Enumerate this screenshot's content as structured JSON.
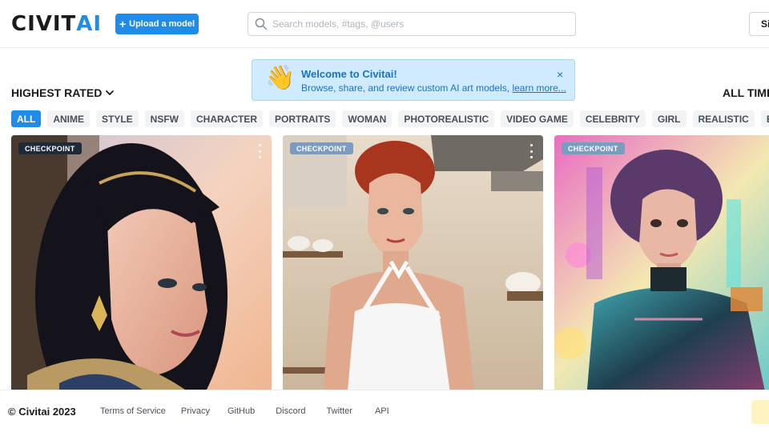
{
  "header": {
    "logo_main": "CIVIT",
    "logo_accent": "AI",
    "upload_label": "Upload a model",
    "search_placeholder": "Search models, #tags, @users",
    "signin_label": "Si"
  },
  "welcome": {
    "title": "Welcome to Civitai!",
    "text": "Browse, share, and review custom AI art models,",
    "link": "learn more...",
    "close": "×",
    "emoji": "👋"
  },
  "sort": {
    "label": "HIGHEST RATED"
  },
  "period": {
    "label": "ALL TIME"
  },
  "tags": [
    "ALL",
    "ANIME",
    "STYLE",
    "NSFW",
    "CHARACTER",
    "PORTRAITS",
    "WOMAN",
    "PHOTOREALISTIC",
    "VIDEO GAME",
    "CELEBRITY",
    "GIRL",
    "REALISTIC",
    "EMBEDD"
  ],
  "cards": [
    {
      "badge": "CHECKPOINT"
    },
    {
      "badge": "CHECKPOINT"
    },
    {
      "badge": "CHECKPOINT"
    }
  ],
  "footer": {
    "copyright": "© Civitai 2023",
    "links": [
      "Terms of Service",
      "Privacy",
      "GitHub",
      "Discord",
      "Twitter",
      "API"
    ]
  },
  "colors": {
    "accent": "#228be6",
    "toast_bg": "#d0ebff",
    "toast_text": "#1971c2"
  },
  "icons": {
    "search": "search-icon",
    "sort": "chevron-down-icon",
    "menu": "dots-vertical-icon",
    "close": "close-icon"
  }
}
